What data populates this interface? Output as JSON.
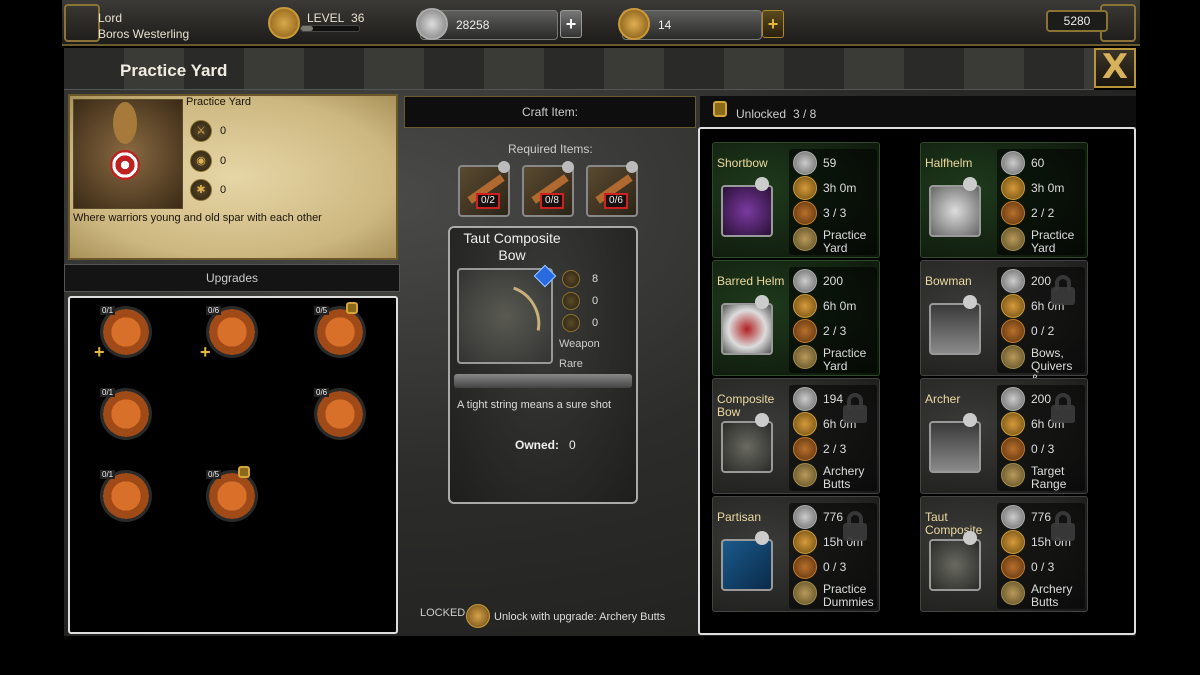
{
  "player": {
    "title": "Lord",
    "name": "Boros Westerling",
    "level_label": "LEVEL",
    "level": "36",
    "xp_progress": 0.2
  },
  "resources": {
    "silver": "28258",
    "gold": "14",
    "right_value": "5280"
  },
  "window": {
    "title": "Practice Yard",
    "close_label": "X"
  },
  "building": {
    "name": "Practice Yard",
    "stats": [
      "0",
      "0",
      "0"
    ],
    "description": "Where warriors young and old spar with each other"
  },
  "upgrades": {
    "header": "Upgrades",
    "items": [
      {
        "count": "0/1",
        "locked": false,
        "plus": true
      },
      {
        "count": "0/6",
        "locked": false,
        "plus": true
      },
      {
        "count": "0/5",
        "locked": true,
        "plus": false
      },
      {
        "count": "0/1",
        "locked": false,
        "plus": false
      },
      {
        "count": "0/6",
        "locked": false,
        "plus": false
      },
      {
        "count": "0/1",
        "locked": false,
        "plus": false
      },
      {
        "count": "0/5",
        "locked": true,
        "plus": false
      }
    ]
  },
  "craft": {
    "header": "Craft Item:",
    "required_label": "Required Items:",
    "required": [
      "0/2",
      "0/8",
      "0/6"
    ],
    "item": {
      "name": "Taut Composite Bow",
      "stats": [
        "8",
        "0",
        "0"
      ],
      "type": "Weapon",
      "rarity": "Rare",
      "description": "A tight string means a sure shot",
      "owned_label": "Owned:",
      "owned": "0"
    },
    "locked_label": "LOCKED",
    "unlock_text": "Unlock with upgrade: Archery Butts"
  },
  "recipes": {
    "unlocked_label": "Unlocked",
    "unlocked_count": "3 / 8",
    "items": [
      {
        "name": "Shortbow",
        "cost": "59",
        "time": "3h 0m",
        "level": "3  /  3",
        "building": "Practice Yard",
        "locked": false
      },
      {
        "name": "Halfhelm",
        "cost": "60",
        "time": "3h 0m",
        "level": "2  /  2",
        "building": "Practice Yard",
        "locked": false
      },
      {
        "name": "Barred Helm",
        "cost": "200",
        "time": "6h 0m",
        "level": "2  /  3",
        "building": "Practice Yard",
        "locked": false
      },
      {
        "name": "Bowman",
        "cost": "200",
        "time": "6h 0m",
        "level": "0  /  2",
        "building": "Bows, Quivers &...",
        "locked": true
      },
      {
        "name": "Composite Bow",
        "cost": "194",
        "time": "6h 0m",
        "level": "2  /  3",
        "building": "Archery Butts",
        "locked": true
      },
      {
        "name": "Archer",
        "cost": "200",
        "time": "6h 0m",
        "level": "0  /  3",
        "building": "Target Range",
        "locked": true
      },
      {
        "name": "Partisan",
        "cost": "776",
        "time": "15h 0m",
        "level": "0  /  3",
        "building": "Practice Dummies",
        "locked": true
      },
      {
        "name": "Taut Composite",
        "cost": "776",
        "time": "15h 0m",
        "level": "0  /  3",
        "building": "Archery Butts",
        "locked": true
      }
    ]
  }
}
